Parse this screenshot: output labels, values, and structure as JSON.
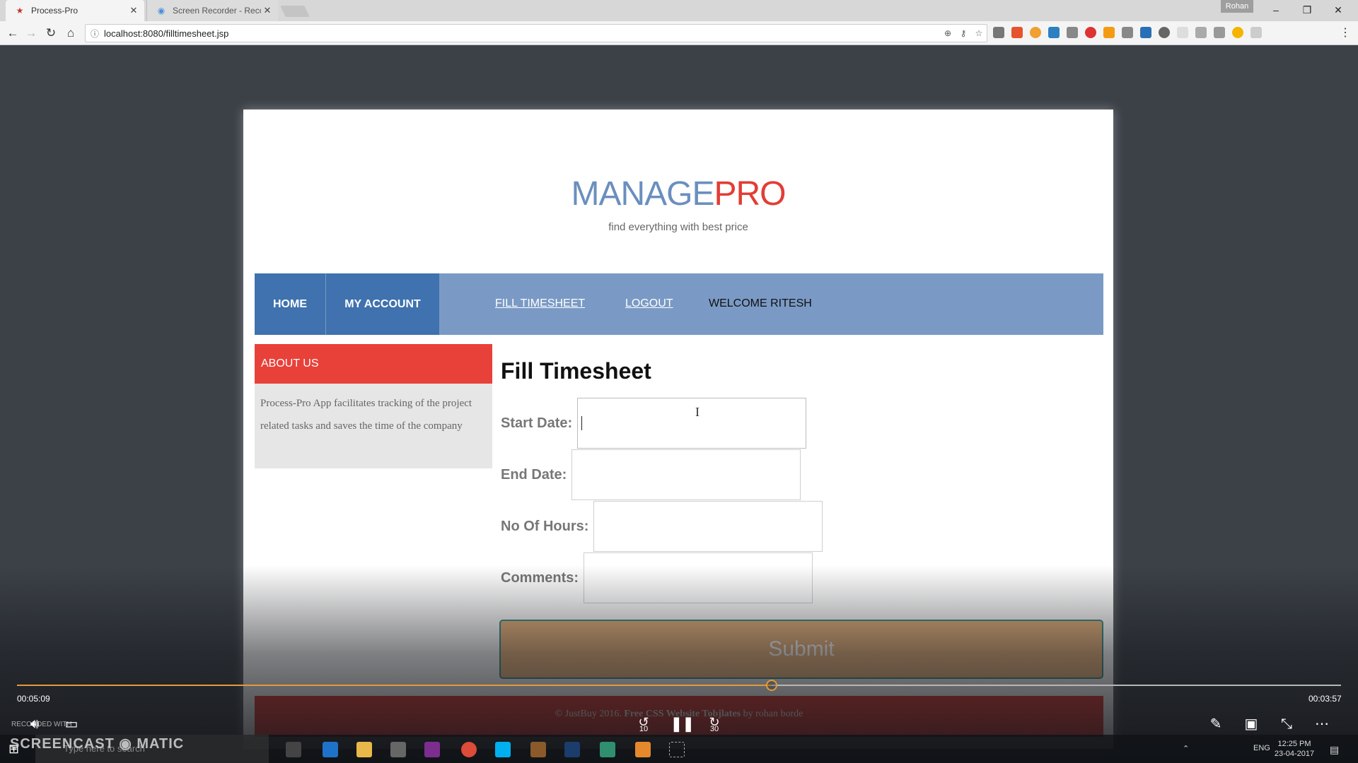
{
  "browser": {
    "tabs": [
      {
        "title": "Process-Pro",
        "active": true
      },
      {
        "title": "Screen Recorder - Recor",
        "active": false
      }
    ],
    "profile_name": "Rohan",
    "url": "localhost:8080/filltimesheet.jsp",
    "window_buttons": {
      "minimize": "–",
      "restore": "❐",
      "close": "✕"
    }
  },
  "site": {
    "brand_part1": "MANAGE",
    "brand_part2": "PRO",
    "tagline": "find everything with best price",
    "colors": {
      "brand_blue": "#6b8fbe",
      "brand_red": "#e23d35",
      "nav_dark": "#3f72ae",
      "nav_light": "#7a9ac5",
      "submit": "#e7b37f"
    },
    "nav": {
      "home": "HOME",
      "my_account": "MY ACCOUNT",
      "fill_timesheet": "FILL TIMESHEET",
      "logout": "LOGOUT",
      "welcome": "WELCOME RITESH"
    },
    "about": {
      "heading": "ABOUT US",
      "text": "Process-Pro App facilitates tracking of the project related tasks and saves the time of the company"
    },
    "form": {
      "title": "Fill Timesheet",
      "start_date_label": "Start Date:",
      "end_date_label": "End Date:",
      "hours_label": "No Of Hours:",
      "comments_label": "Comments:",
      "start_date_value": "",
      "end_date_value": "",
      "hours_value": "",
      "comments_value": "",
      "submit_label": "Submit"
    },
    "footer": {
      "copyright": "© JustBuy 2016.",
      "link_text": "Free CSS Website Tobjlates",
      "credit": "by rohan borde"
    }
  },
  "player": {
    "elapsed": "00:05:09",
    "remaining": "00:03:57",
    "progress_fraction": 0.57,
    "watermark": "SCREENCAST ◉ MATIC",
    "recorded_label": "RECORDED WITH"
  },
  "taskbar": {
    "search_placeholder": "Type here to search",
    "language": "ENG",
    "time": "12:25 PM",
    "date": "23-04-2017"
  }
}
